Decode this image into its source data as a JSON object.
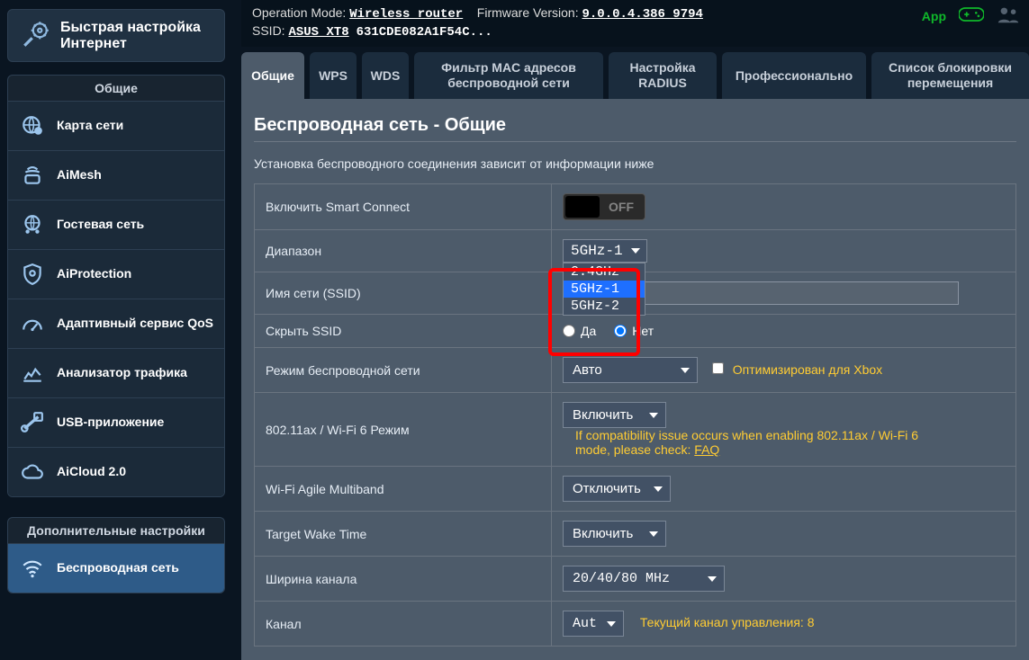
{
  "header": {
    "op_mode_label": "Operation Mode:",
    "op_mode_value": "Wireless router",
    "fw_label": "Firmware Version:",
    "fw_value": "9.0.0.4.386_9794",
    "ssid_label": "SSID:",
    "ssid_value": "ASUS_XT8",
    "ssid_mac": "631CDE082A1F54C...",
    "app_label": "App"
  },
  "tabs": [
    "Общие",
    "WPS",
    "WDS",
    "Фильтр MAC адресов беспроводной сети",
    "Настройка RADIUS",
    "Профессионально",
    "Список блокировки перемещения"
  ],
  "sidebar": {
    "quick_setup": "Быстрая настройка Интернет",
    "general_head": "Общие",
    "general_items": [
      "Карта сети",
      "AiMesh",
      "Гостевая сеть",
      "AiProtection",
      "Адаптивный сервис QoS",
      "Анализатор трафика",
      "USB-приложение",
      "AiCloud 2.0"
    ],
    "advanced_head": "Дополнительные настройки",
    "advanced_items": [
      "Беспроводная сеть"
    ]
  },
  "page": {
    "title": "Беспроводная сеть - Общие",
    "desc": "Установка беспроводного соединения зависит от информации ниже"
  },
  "rows": {
    "smart_connect_label": "Включить Smart Connect",
    "smart_connect_state": "OFF",
    "band_label": "Диапазон",
    "band_selected": "5GHz-1",
    "band_options": [
      "2.4GHz",
      "5GHz-1",
      "5GHz-2"
    ],
    "ssid_label": "Имя сети (SSID)",
    "hide_ssid_label": "Скрыть SSID",
    "yes": "Да",
    "no": "Нет",
    "mode_label": "Режим беспроводной сети",
    "mode_value": "Авто",
    "xbox_opt": "Оптимизирован для Xbox",
    "ax_label": "802.11ax / Wi-Fi 6 Режим",
    "ax_value": "Включить",
    "ax_help": "If compatibility issue occurs when enabling 802.11ax / Wi-Fi 6 mode, please check:",
    "ax_faq": "FAQ",
    "agile_label": "Wi-Fi Agile Multiband",
    "agile_value": "Отключить",
    "twt_label": "Target Wake Time",
    "twt_value": "Включить",
    "chwidth_label": "Ширина канала",
    "chwidth_value": "20/40/80 MHz",
    "channel_label": "Канал",
    "channel_value": "Auto",
    "channel_note": "Текущий канал управления: 8"
  }
}
